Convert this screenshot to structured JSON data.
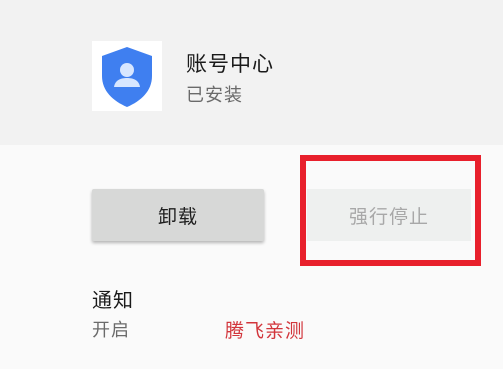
{
  "app": {
    "icon": "account-shield-icon",
    "name": "账号中心",
    "status": "已安装"
  },
  "actions": {
    "uninstall_label": "卸载",
    "force_stop_label": "强行停止"
  },
  "notifications": {
    "title": "通知",
    "value": "开启"
  },
  "watermark": "腾飞亲测",
  "colors": {
    "header_bg": "#f2f2f2",
    "icon_blue": "#3f7ff0",
    "highlight_red": "#e8202c",
    "watermark_red": "#d2353b"
  }
}
